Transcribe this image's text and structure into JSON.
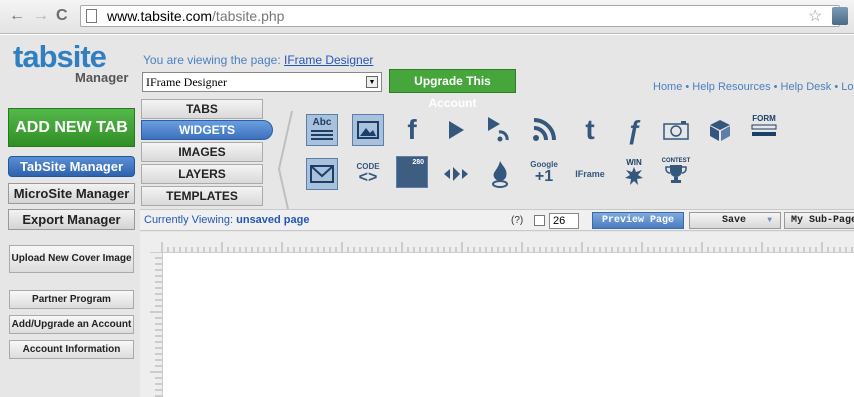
{
  "browser": {
    "url_domain": "www.tabsite.com",
    "url_path": "/tabsite.php"
  },
  "logo": {
    "name": "tabsite",
    "sub": "Manager"
  },
  "header": {
    "viewing_prefix": "You are viewing the page: ",
    "viewing_page": "IFrame Designer",
    "page_select_value": "IFrame Designer",
    "upgrade_label": "Upgrade This Account",
    "top_links": "Home • Help Resources • Help Desk • Lo"
  },
  "sidebar": {
    "add_new_tab": "ADD NEW TAB",
    "managers": [
      "TabSite Manager",
      "MicroSite Manager",
      "Export Manager"
    ],
    "buttons": [
      "Upload New Cover Image",
      "Partner Program",
      "Add/Upgrade an Account",
      "Account Information"
    ]
  },
  "menu": {
    "items": [
      "TABS",
      "WIDGETS",
      "IMAGES",
      "LAYERS",
      "TEMPLATES"
    ],
    "active": "WIDGETS"
  },
  "widgets": {
    "row1": [
      "text-widget-icon",
      "image-widget-icon",
      "facebook-icon",
      "video-play-icon",
      "podcast-icon",
      "rss-icon",
      "twitter-icon",
      "flash-icon",
      "camera-icon",
      "box-icon",
      "form-icon"
    ],
    "row2": [
      "email-icon",
      "code-icon",
      "calendar-widget-icon",
      "slider-icon",
      "fire-icon",
      "google-plus-icon",
      "iframe-icon",
      "win-badge-icon",
      "contest-trophy-icon"
    ],
    "labels": {
      "abc": "Abc",
      "form": "FORM",
      "code": "CODE",
      "calendar_num": "280",
      "google": "Google",
      "plus_one": "+1",
      "iframe": "IFrame",
      "win": "WIN",
      "contest": "CONTEST"
    }
  },
  "toolbar": {
    "currently_viewing_label": "Currently Viewing:",
    "currently_viewing_value": "unsaved page",
    "help": "(?)",
    "number": "26",
    "preview": "Preview Page",
    "save": "Save",
    "subpage": "My Sub-Page"
  },
  "colors": {
    "brand_blue": "#2f7fc1",
    "accent_green": "#46a53b",
    "active_blue": "#3c71bd"
  }
}
